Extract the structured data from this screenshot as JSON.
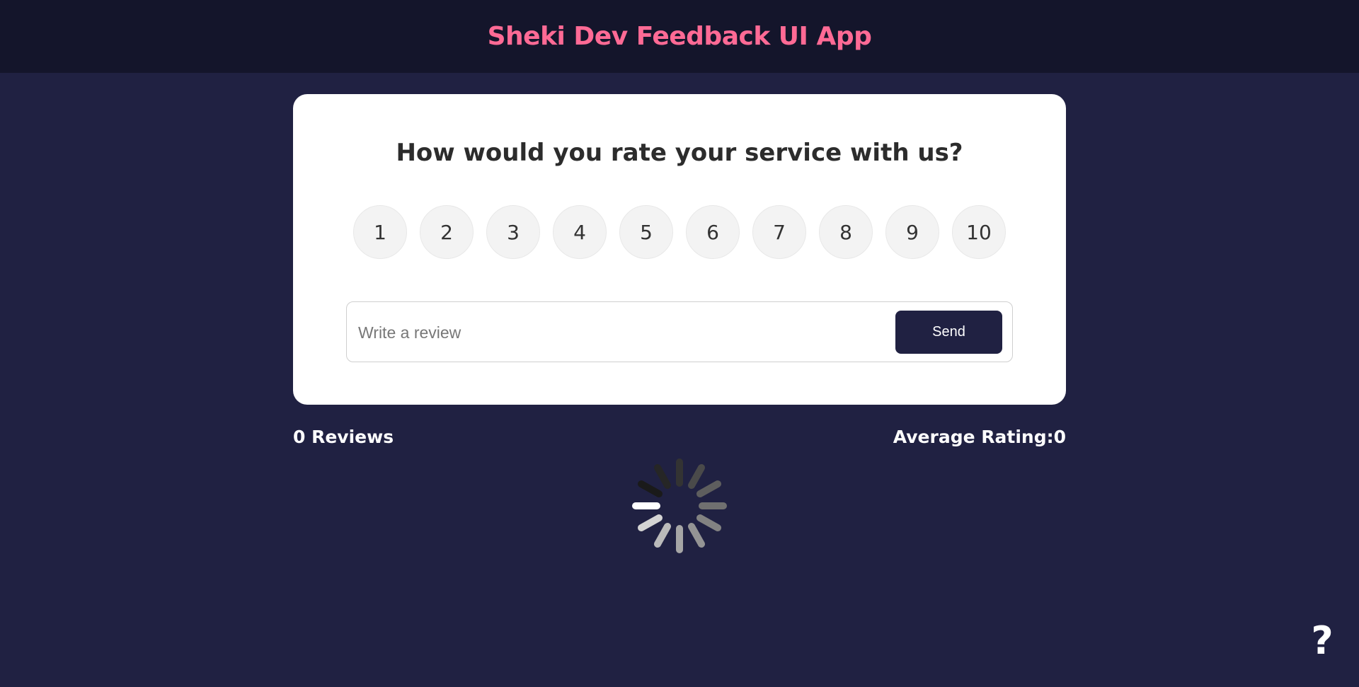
{
  "header": {
    "title": "Sheki Dev Feedback UI App"
  },
  "card": {
    "question": "How would you rate your service with us?",
    "ratings": [
      "1",
      "2",
      "3",
      "4",
      "5",
      "6",
      "7",
      "8",
      "9",
      "10"
    ],
    "review": {
      "placeholder": "Write a review",
      "value": "",
      "send_label": "Send"
    }
  },
  "stats": {
    "reviews": "0 Reviews",
    "average": "Average Rating:0"
  },
  "loading": {
    "icon": "spinner-icon"
  },
  "help": {
    "icon": "help-icon",
    "label": "?"
  },
  "colors": {
    "accent": "#ff6a95",
    "background": "#202142",
    "header_bg": "#14152b"
  }
}
